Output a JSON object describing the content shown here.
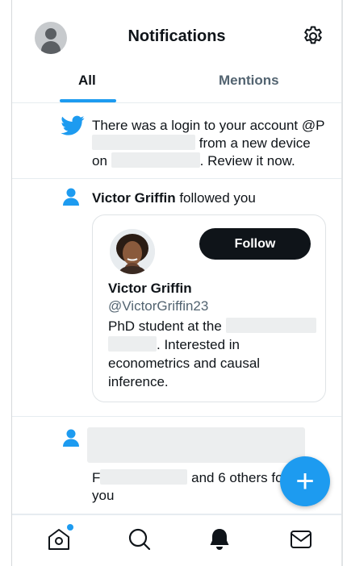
{
  "header": {
    "title": "Notifications"
  },
  "tabs": [
    {
      "label": "All",
      "active": true
    },
    {
      "label": "Mentions",
      "active": false
    }
  ],
  "notifications": [
    {
      "type": "login",
      "icon": "twitter-bird-icon",
      "text_part1": "There was a login to your account @P",
      "text_part2": " from a new device on ",
      "text_part3": ". Review it now."
    },
    {
      "type": "follow",
      "icon": "person-icon",
      "actor_name": "Victor Griffin",
      "action": " followed you",
      "card": {
        "name": "Victor Griffin",
        "handle": "@VictorGriffin23",
        "bio_part1": "PhD student at the",
        "bio_part2": ". Interested in econometrics and causal inference.",
        "follow_label": "Follow"
      }
    },
    {
      "type": "follow-group",
      "icon": "person-icon",
      "text_prefix": "F",
      "text_suffix": " and 6 others fol",
      "text_line2": "you"
    }
  ],
  "fab": {
    "label": "+"
  },
  "colors": {
    "accent": "#1d9bf0",
    "text_primary": "#0f1419",
    "text_secondary": "#536471",
    "follow_button_bg": "#0f1419"
  },
  "bottom_nav": [
    {
      "icon": "home-icon",
      "has_badge": true
    },
    {
      "icon": "search-icon"
    },
    {
      "icon": "bell-icon",
      "active": true
    },
    {
      "icon": "mail-icon"
    }
  ]
}
